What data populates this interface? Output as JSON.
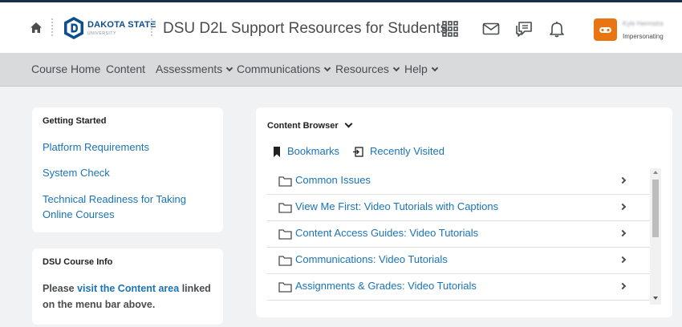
{
  "header": {
    "logo_text": "DAKOTA STATE",
    "logo_subtext": "UNIVERSITY",
    "course_title": "DSU D2L Support Resources for Students",
    "user_name": "Kyle Hermstra",
    "user_role": "Impersonating",
    "icons": [
      "home-icon",
      "waffle-grid-icon",
      "envelope-icon",
      "chat-bubbles-icon",
      "bell-icon"
    ],
    "accent_color": "#e87511"
  },
  "navbar": {
    "items": [
      {
        "label": "Course Home",
        "has_menu": false
      },
      {
        "label": "Content",
        "has_menu": false
      },
      {
        "label": "Assessments",
        "has_menu": true
      },
      {
        "label": "Communications",
        "has_menu": true
      },
      {
        "label": "Resources",
        "has_menu": true
      },
      {
        "label": "Help",
        "has_menu": true
      }
    ]
  },
  "getting_started": {
    "heading": "Getting Started",
    "links": [
      "Platform Requirements",
      "System Check",
      "Technical Readiness for Taking Online Courses"
    ]
  },
  "course_info": {
    "heading": "DSU Course Info",
    "text_before": "Please ",
    "link_text": "visit the Content area",
    "text_after": " linked on the menu bar above."
  },
  "content_browser": {
    "heading": "Content Browser",
    "bookmarks_label": "Bookmarks",
    "recently_visited_label": "Recently Visited",
    "items": [
      "Common Issues",
      "View Me First: Video Tutorials with Captions",
      "Content Access Guides: Video Tutorials",
      "Communications: Video Tutorials",
      "Assignments & Grades: Video Tutorials"
    ]
  },
  "colors": {
    "link": "#1a73b8",
    "nav_bg": "#d9dadc",
    "page_bg": "#f1f2f4",
    "brand_blue": "#0d4e8c"
  }
}
